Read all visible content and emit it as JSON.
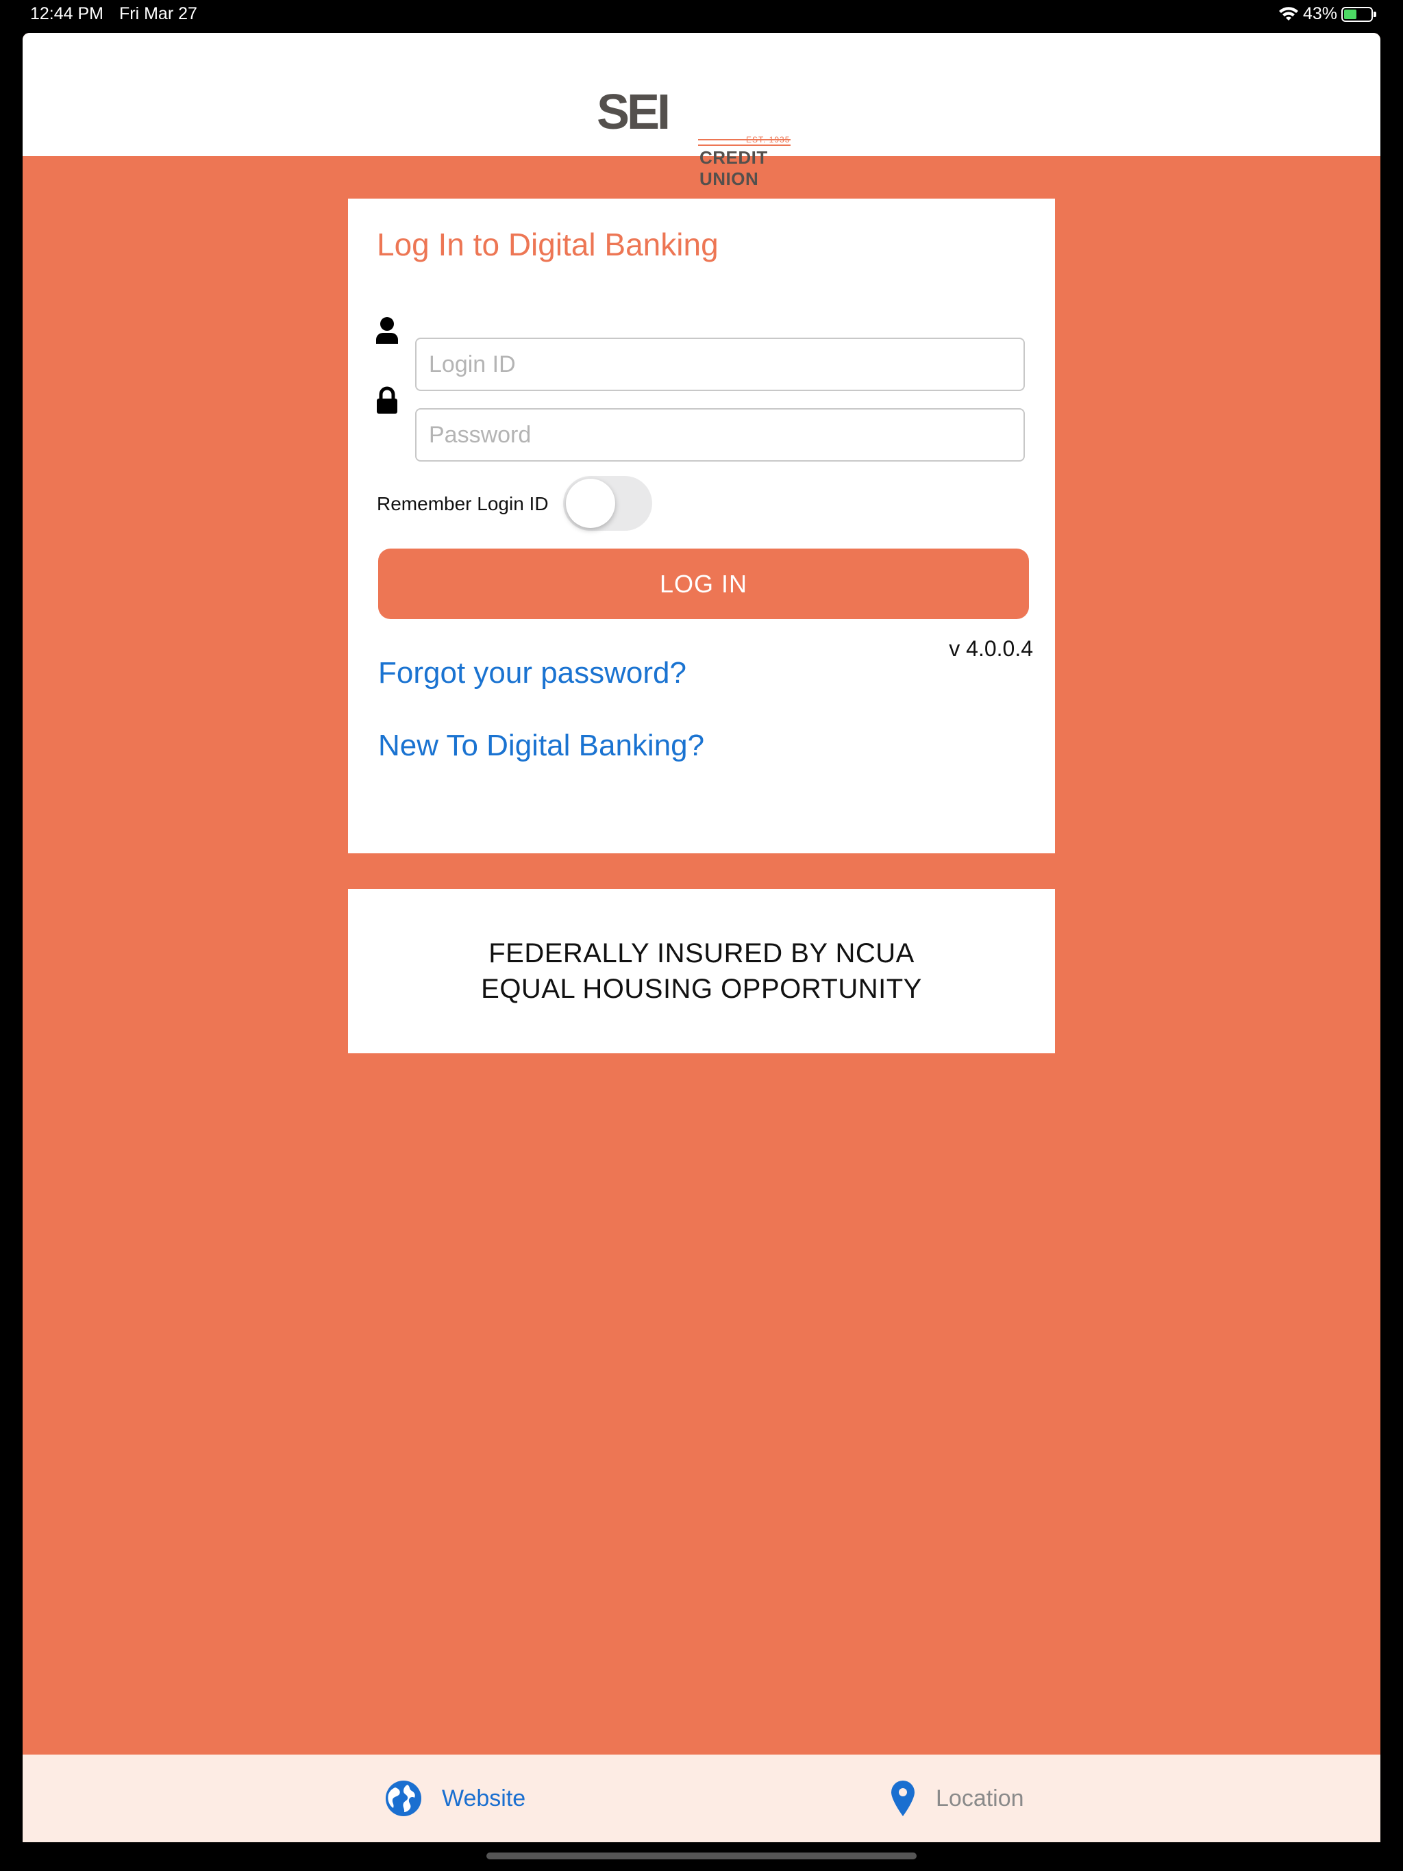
{
  "status_bar": {
    "time": "12:44 PM",
    "date": "Fri Mar 27",
    "battery": "43%",
    "battery_level": 0.43
  },
  "header": {
    "logo": {
      "brand": "SEI",
      "subtitle": "CREDIT UNION",
      "est": "EST. 1935"
    }
  },
  "login": {
    "title": "Log In to Digital Banking",
    "login_placeholder": "Login ID",
    "password_placeholder": "Password",
    "remember_label": "Remember Login ID",
    "remember_on": false,
    "login_button": "LOG IN",
    "version": "v 4.0.0.4",
    "forgot_link": "Forgot your password?",
    "new_link": "New To Digital Banking?"
  },
  "notice": {
    "line1": "FEDERALLY INSURED BY NCUA",
    "line2": "EQUAL HOUSING OPPORTUNITY"
  },
  "footer": {
    "website": "Website",
    "location": "Location"
  },
  "colors": {
    "accent": "#ed7654",
    "link": "#1a73d1",
    "footer_bg": "#fdece4"
  }
}
